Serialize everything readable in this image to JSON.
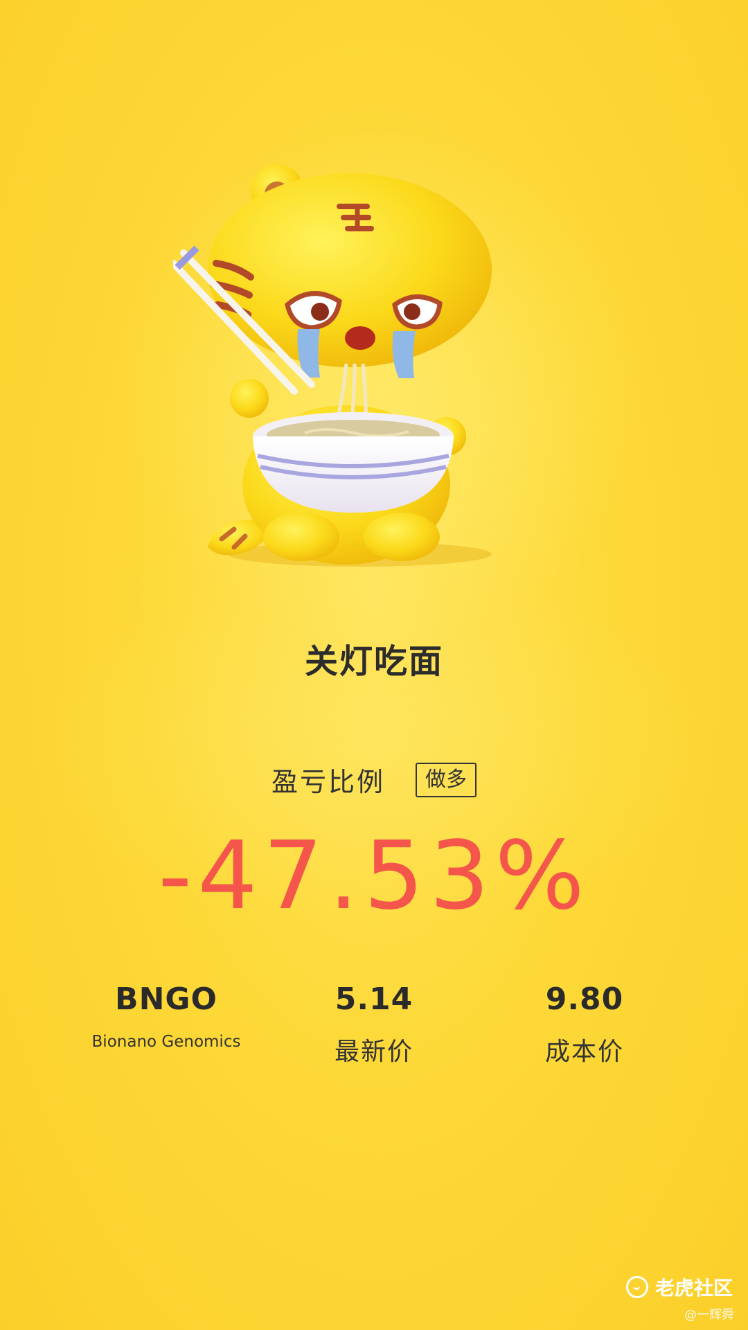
{
  "mascot": {
    "icon": "tiger-eating-noodles-crying"
  },
  "headline": "关灯吃面",
  "ratio": {
    "label": "盈亏比例",
    "tag": "做多",
    "value": "-47.53%"
  },
  "stock": {
    "ticker": "BNGO",
    "name": "Bionano Genomics"
  },
  "latest_price": {
    "value": "5.14",
    "label": "最新价"
  },
  "cost_price": {
    "value": "9.80",
    "label": "成本价"
  },
  "brand": {
    "name": "老虎社区",
    "handle": "@一辉舜"
  },
  "colors": {
    "background": "#fcd630",
    "loss": "#f4564b",
    "text": "#2c2c2c"
  }
}
